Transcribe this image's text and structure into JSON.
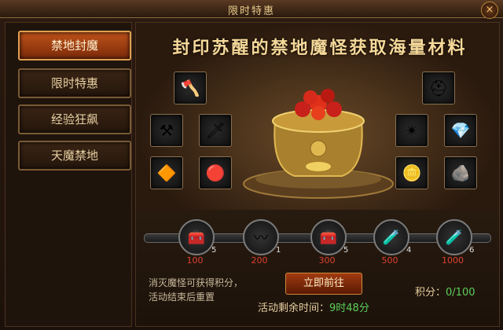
{
  "window": {
    "title": "限时特惠",
    "close_icon": "×"
  },
  "sidebar": {
    "items": [
      {
        "label": "禁地封魔",
        "active": true
      },
      {
        "label": "限时特惠",
        "active": false
      },
      {
        "label": "经验狂飙",
        "active": false
      },
      {
        "label": "天魔禁地",
        "active": false
      }
    ]
  },
  "banner": {
    "headline": "封印苏醒的禁地魔怪获取海量材料"
  },
  "reward_slots": [
    {
      "icon": "axe-icon",
      "glyph": "🪓"
    },
    {
      "icon": "mace-icon",
      "glyph": "⚒"
    },
    {
      "icon": "sword-icon",
      "glyph": "🗡"
    },
    {
      "icon": "gem-icon",
      "glyph": "🔶"
    },
    {
      "icon": "orb-icon",
      "glyph": "🔴"
    },
    {
      "icon": "helmet-icon",
      "glyph": "⛑"
    },
    {
      "icon": "claw-icon",
      "glyph": "✴"
    },
    {
      "icon": "crystal-icon",
      "glyph": "💎"
    },
    {
      "icon": "coin-icon",
      "glyph": "🪙"
    },
    {
      "icon": "stone-icon",
      "glyph": "🪨"
    }
  ],
  "progress": {
    "nodes": [
      {
        "icon": "chest-icon",
        "glyph": "🧰",
        "count": "5",
        "points": "100"
      },
      {
        "icon": "wings-icon",
        "glyph": "〰",
        "count": "1",
        "points": "200"
      },
      {
        "icon": "treasure-chest-icon",
        "glyph": "🧰",
        "count": "5",
        "points": "300"
      },
      {
        "icon": "potion-icon",
        "glyph": "🧪",
        "count": "4",
        "points": "500"
      },
      {
        "icon": "potion-icon",
        "glyph": "🧪",
        "count": "6",
        "points": "1000"
      }
    ]
  },
  "footer": {
    "desc_line1": "消灭魔怪可获得积分，",
    "desc_line2": "活动结束后重置",
    "go_button": "立即前往",
    "score_label": "积分：",
    "score_value": "0/100",
    "timer_label": "活动剩余时间：",
    "timer_value": "9时48分"
  },
  "colors": {
    "accent": "#c0521a",
    "score_green": "#5ad05a",
    "points_red": "#e04030"
  }
}
